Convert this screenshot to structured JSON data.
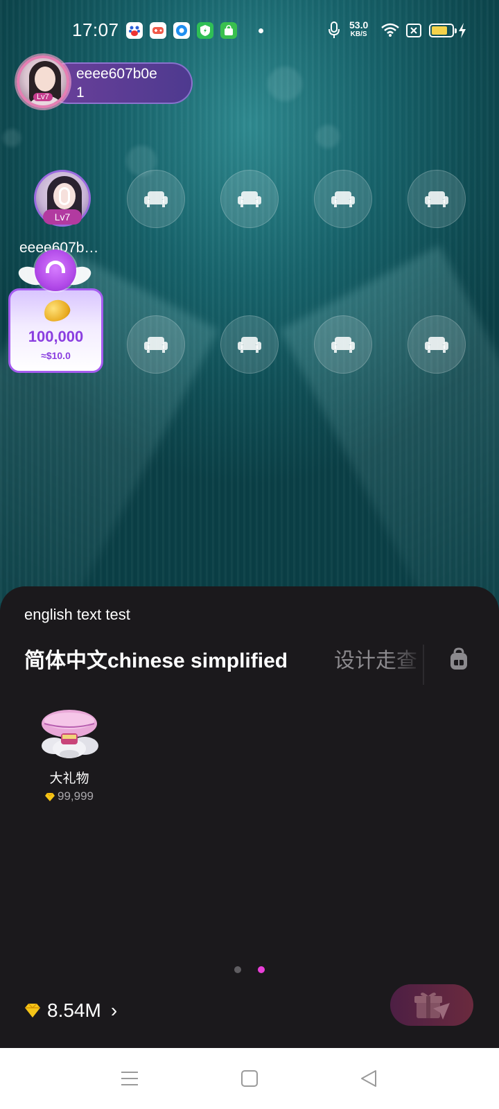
{
  "status_bar": {
    "time": "17:07",
    "net_speed_value": "53.0",
    "net_speed_unit": "KB/S",
    "icons": [
      "baidu-app-icon",
      "game-app-icon",
      "browser-app-icon",
      "security-app-icon",
      "store-app-icon",
      "notification-dot",
      "mic-icon",
      "wifi-icon",
      "close-box-icon",
      "battery-icon",
      "charging-icon"
    ],
    "battery_fraction": 0.8
  },
  "host": {
    "name": "eeee607b0e",
    "count": "1",
    "level": "Lv7"
  },
  "seats": {
    "occupied": {
      "name": "eeee607b…",
      "level": "Lv7"
    },
    "empty_icon": "sofa-icon"
  },
  "red_packet": {
    "amount": "100,000",
    "usd": "≈$10.0"
  },
  "gift_panel": {
    "subtitle": "english text test",
    "tabs": [
      {
        "label": "简体中文chinese simplified",
        "active": true
      },
      {
        "label": "设计走查",
        "active": false
      }
    ],
    "bag_icon": "backpack-icon",
    "gifts": [
      {
        "name": "大礼物",
        "price": "99,999",
        "icon": "airship-gift-icon"
      }
    ],
    "page_count": 2,
    "active_page": 2,
    "balance": "8.54M",
    "balance_chevron": "›",
    "send_icon": "gift-send-icon",
    "colors": {
      "accent": "#e93fd8",
      "panel_bg": "#1b191c",
      "packet_purple": "#8a3ee0"
    }
  },
  "navbar": {
    "buttons": [
      "menu-icon",
      "home-icon",
      "back-icon"
    ]
  }
}
